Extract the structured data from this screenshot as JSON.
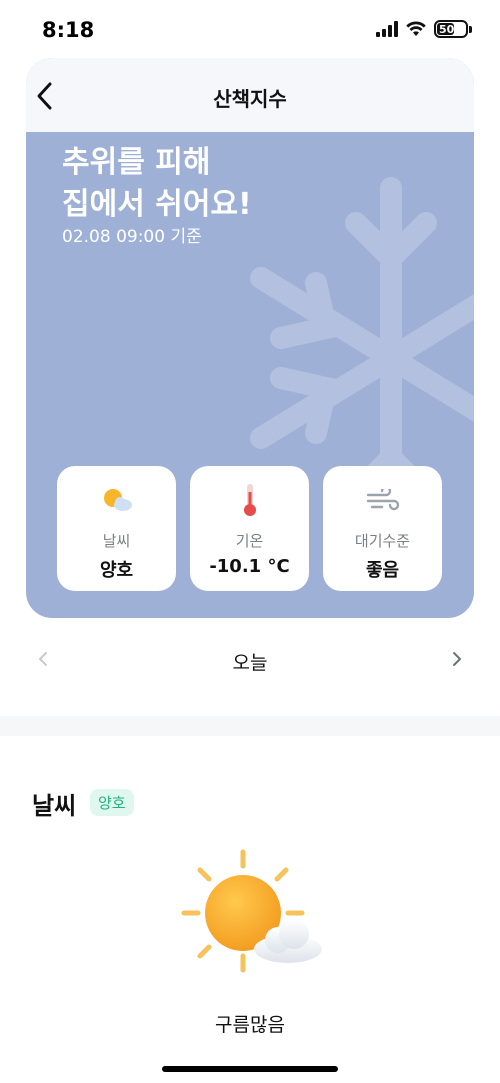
{
  "status_bar": {
    "time": "8:18",
    "battery_level": "50"
  },
  "header": {
    "title": "산책지수"
  },
  "hero": {
    "headline_line1": "추위를 피해",
    "headline_line2": "집에서 쉬어요!",
    "timestamp": "02.08 09:00 기준"
  },
  "metrics": [
    {
      "icon": "sun-cloud-icon",
      "label": "날씨",
      "value": "양호"
    },
    {
      "icon": "thermometer-icon",
      "label": "기온",
      "value": "-10.1 °C"
    },
    {
      "icon": "wind-icon",
      "label": "대기수준",
      "value": "좋음"
    }
  ],
  "day_nav": {
    "label": "오늘"
  },
  "weather": {
    "title": "날씨",
    "badge": "양호",
    "description": "구름많음"
  },
  "colors": {
    "hero_bg": "#9fb0d6",
    "badge_bg": "#dff7ee",
    "badge_text": "#1fb37f"
  }
}
